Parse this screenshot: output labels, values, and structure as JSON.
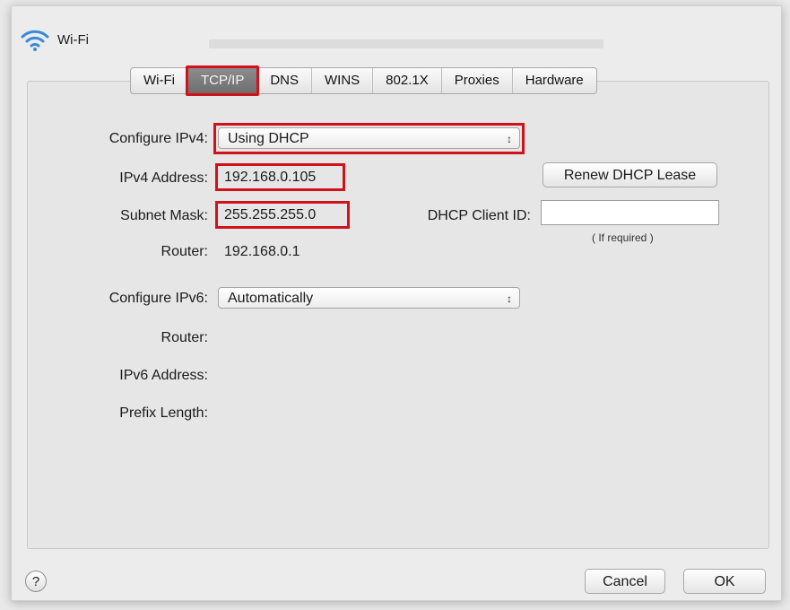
{
  "window": {
    "title": "Wi-Fi"
  },
  "tabs": [
    {
      "label": "Wi-Fi",
      "active": false
    },
    {
      "label": "TCP/IP",
      "active": true
    },
    {
      "label": "DNS",
      "active": false
    },
    {
      "label": "WINS",
      "active": false
    },
    {
      "label": "802.1X",
      "active": false
    },
    {
      "label": "Proxies",
      "active": false
    },
    {
      "label": "Hardware",
      "active": false
    }
  ],
  "ipv4": {
    "configure_label": "Configure IPv4:",
    "configure_value": "Using DHCP",
    "address_label": "IPv4 Address:",
    "address_value": "192.168.0.105",
    "subnet_label": "Subnet Mask:",
    "subnet_value": "255.255.255.0",
    "router_label": "Router:",
    "router_value": "192.168.0.1",
    "renew_button": "Renew DHCP Lease",
    "client_id_label": "DHCP Client ID:",
    "client_id_value": "",
    "client_id_hint": "( If required )"
  },
  "ipv6": {
    "configure_label": "Configure IPv6:",
    "configure_value": "Automatically",
    "router_label": "Router:",
    "address_label": "IPv6 Address:",
    "prefix_label": "Prefix Length:"
  },
  "footer": {
    "help_label": "?",
    "cancel_button": "Cancel",
    "ok_button": "OK"
  },
  "colors": {
    "highlight": "#d0121b",
    "active_tab": "#7a7a7a"
  }
}
